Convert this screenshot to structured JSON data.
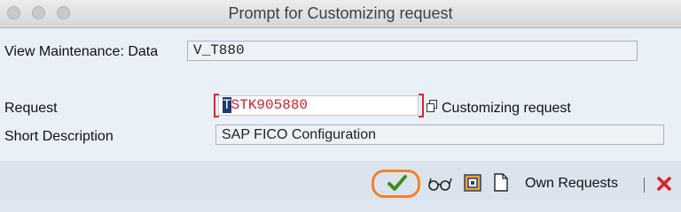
{
  "window": {
    "title": "Prompt for Customizing request"
  },
  "form": {
    "view_maintenance_label": "View Maintenance: Data",
    "view_maintenance_value": "V_T880",
    "request_label": "Request",
    "request_cursor_char": "T",
    "request_value_rest": "STK905880",
    "customizing_request_label": "Customizing request",
    "short_description_label": "Short Description",
    "short_description_value": "SAP FICO Configuration"
  },
  "toolbar": {
    "own_requests_label": "Own Requests",
    "icons": [
      "continue-check-icon",
      "glasses-icon",
      "create-request-icon",
      "new-document-icon",
      "cancel-x-icon"
    ]
  },
  "colors": {
    "accent_orange": "#f0822a",
    "error_red": "#e2222a",
    "check_green": "#3a8f1e"
  }
}
